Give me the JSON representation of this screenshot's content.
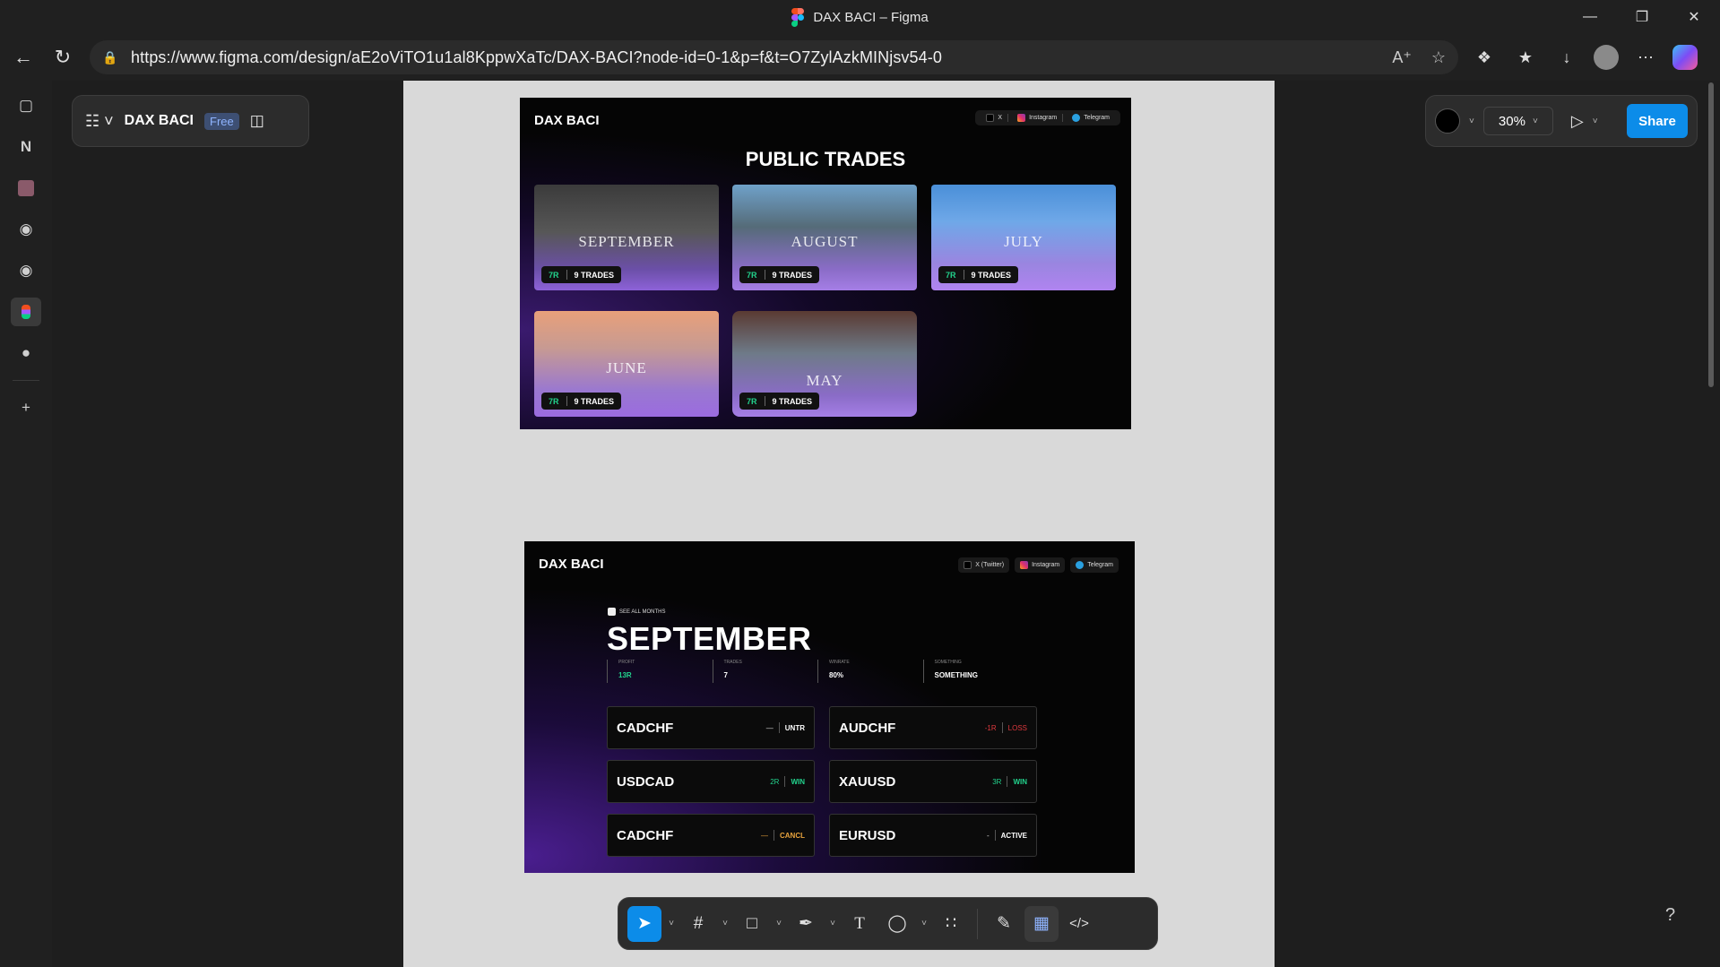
{
  "window": {
    "title": "DAX BACI – Figma",
    "controls": [
      "minimize",
      "restore",
      "close"
    ]
  },
  "browser": {
    "url": "https://www.figma.com/design/aE2oViTO1u1al8KppwXaTc/DAX-BACI?node-id=0-1&p=f&t=O7ZylAzkMINjsv54-0",
    "sidebar_icons": [
      "tabs-icon",
      "notion-icon",
      "profile-icon",
      "github-icon",
      "github-icon",
      "figma-icon",
      "github-icon",
      "add-icon"
    ]
  },
  "figma": {
    "file_name": "DAX BACI",
    "plan_badge": "Free",
    "zoom": "30%",
    "share_label": "Share",
    "help_label": "?"
  },
  "frame1": {
    "brand": "DAX BACI",
    "socials": [
      "X",
      "Instagram",
      "Telegram"
    ],
    "title": "PUBLIC TRADES",
    "cards": [
      {
        "month": "SEPTEMBER",
        "r": "7R",
        "trades": "9 TRADES"
      },
      {
        "month": "AUGUST",
        "r": "7R",
        "trades": "9 TRADES"
      },
      {
        "month": "JULY",
        "r": "7R",
        "trades": "9 TRADES"
      },
      {
        "month": "JUNE",
        "r": "7R",
        "trades": "9 TRADES"
      },
      {
        "month": "MAY",
        "r": "7R",
        "trades": "9 TRADES"
      }
    ]
  },
  "frame2": {
    "brand": "DAX BACI",
    "socials": [
      "X (Twitter)",
      "Instagram",
      "Telegram"
    ],
    "see_all": "SEE ALL MONTHS",
    "title": "SEPTEMBER",
    "stats": [
      {
        "key": "PROFIT",
        "value": "13R"
      },
      {
        "key": "TRADES",
        "value": "7"
      },
      {
        "key": "WINRATE",
        "value": "80%"
      },
      {
        "key": "SOMETHING",
        "value": "SOMETHING"
      }
    ],
    "pairs": [
      {
        "symbol": "CADCHF",
        "r": "—",
        "status": "UNTR"
      },
      {
        "symbol": "AUDCHF",
        "r": "-1R",
        "status": "LOSS"
      },
      {
        "symbol": "USDCAD",
        "r": "2R",
        "status": "WIN"
      },
      {
        "symbol": "XAUUSD",
        "r": "3R",
        "status": "WIN"
      },
      {
        "symbol": "CADCHF",
        "r": "—",
        "status": "CANCL"
      },
      {
        "symbol": "EURUSD",
        "r": "-",
        "status": "ACTIVE"
      }
    ]
  },
  "colors": {
    "accent": "#0c8ce9",
    "win": "#22d38d",
    "loss": "#e0393e",
    "cancel": "#e8a33d"
  }
}
